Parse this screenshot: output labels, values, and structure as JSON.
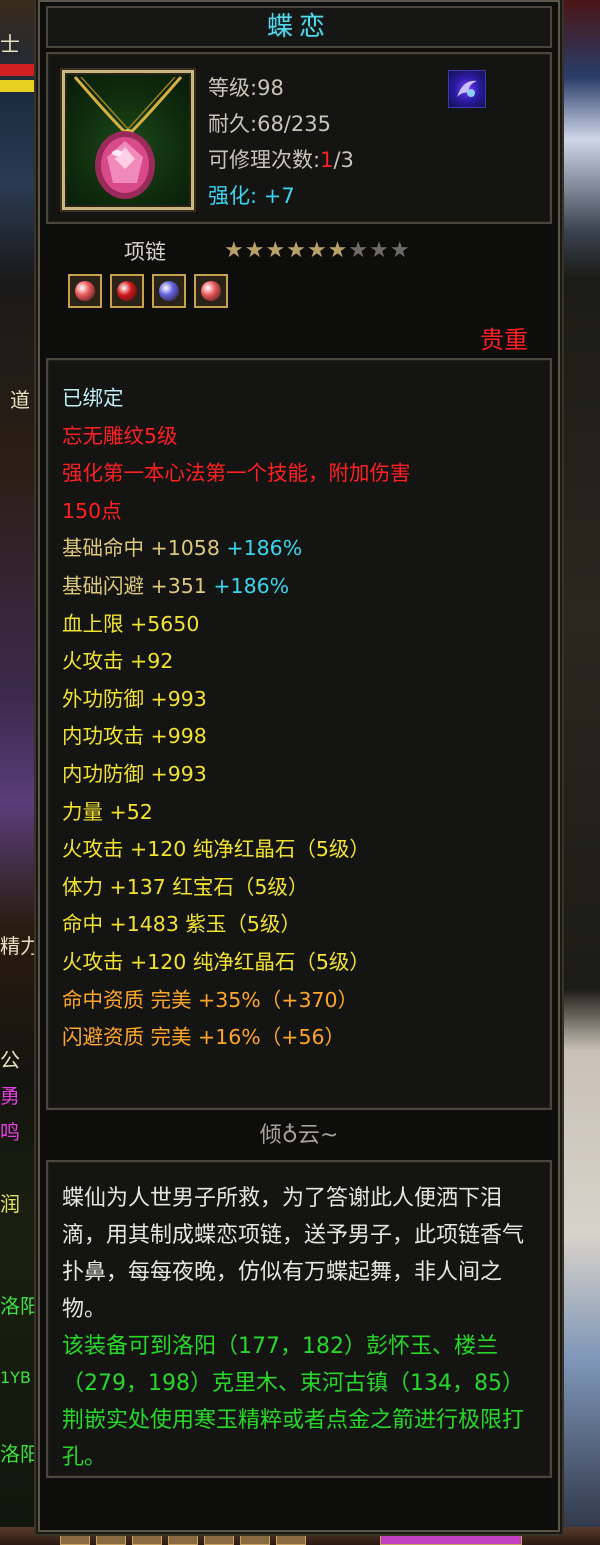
{
  "background": {
    "left_texts": [
      "士",
      "道",
      "精力",
      "公",
      "勇",
      "鸣",
      "润",
      "洛阳",
      "1YB",
      "洛阳"
    ]
  },
  "item": {
    "name": "蝶恋",
    "icon": "pink-gem-necklace-icon",
    "level_label": "等级",
    "level_value": "98",
    "durability_label": "耐久",
    "durability_value": "68/235",
    "repair_label": "可修理次数",
    "repair_used": "1",
    "repair_total": "/3",
    "enhance_label": "强化:",
    "enhance_value": "+7",
    "type": "项链",
    "stars_filled": 6,
    "stars_total": 9,
    "rarity": "贵重",
    "sockets": [
      {
        "icon": "red-crystal-gem-icon",
        "color": "#e8585a"
      },
      {
        "icon": "ruby-gem-icon",
        "color": "#d01818"
      },
      {
        "icon": "purple-jade-gem-icon",
        "color": "#6060e0"
      },
      {
        "icon": "red-crystal-gem-icon",
        "color": "#e8585a"
      }
    ]
  },
  "attributes": [
    {
      "text": "已绑定",
      "color": "bound"
    },
    {
      "text": "忘无雕纹5级",
      "color": "red"
    },
    {
      "text": "强化第一本心法第一个技能，附加伤害",
      "color": "red"
    },
    {
      "text": "150点",
      "color": "red"
    },
    {
      "text": "基础命中 +1058 ",
      "extra": "+186%",
      "color": "gold",
      "extra_color": "cyan"
    },
    {
      "text": "基础闪避 +351 ",
      "extra": "+186%",
      "color": "gold",
      "extra_color": "cyan"
    },
    {
      "text": "血上限 +5650",
      "color": "yel"
    },
    {
      "text": "火攻击 +92",
      "color": "yel"
    },
    {
      "text": "外功防御 +993",
      "color": "yel"
    },
    {
      "text": "内功攻击 +998",
      "color": "yel"
    },
    {
      "text": "内功防御 +993",
      "color": "yel"
    },
    {
      "text": "力量 +52",
      "color": "yel"
    },
    {
      "text": "火攻击 +120 纯净红晶石（5级）",
      "color": "yel"
    },
    {
      "text": "体力 +137 红宝石（5级）",
      "color": "yel"
    },
    {
      "text": "命中 +1483 紫玉（5级）",
      "color": "yel"
    },
    {
      "text": "火攻击 +120 纯净红晶石（5级）",
      "color": "yel"
    },
    {
      "text": "命中资质  完美 +35%（+370）",
      "color": "orange"
    },
    {
      "text": "闪避资质  完美 +16%（+56）",
      "color": "orange"
    }
  ],
  "lore": {
    "title": "倾♁云~",
    "description": "蝶仙为人世男子所救，为了答谢此人便洒下泪滴，用其制成蝶恋项链，送予男子，此项链香气扑鼻，每每夜晚，仿似有万蝶起舞，非人间之物。",
    "notice": "该装备可到洛阳（177，182）彭怀玉、楼兰（279，198）克里木、束河古镇（134，85）荆嵌实处使用寒玉精粹或者点金之箭进行极限打孔。"
  },
  "colors": {
    "title": "#56d6e6",
    "rarity": "#ff2020",
    "bound": "#bfeff5",
    "red": "#ff2020",
    "gold": "#dcc87a",
    "yellow": "#f2e230",
    "orange": "#ffa628",
    "cyan": "#3ad6ef",
    "green": "#28d828"
  }
}
